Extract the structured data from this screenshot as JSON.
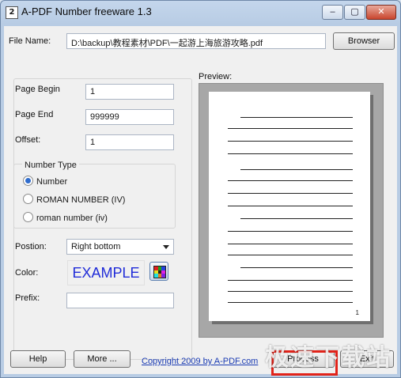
{
  "window": {
    "icon_text": "2",
    "title": "A-PDF Number freeware 1.3",
    "minimize_label": "–",
    "maximize_label": "▢",
    "close_label": "✕"
  },
  "file": {
    "label": "File Name:",
    "value": "D:\\backup\\教程素材\\PDF\\一起游上海旅游攻略.pdf",
    "browse_label": "Browser"
  },
  "settings": {
    "page_begin_label": "Page Begin",
    "page_begin_value": "1",
    "page_end_label": "Page End",
    "page_end_value": "999999",
    "offset_label": "Offset:",
    "offset_value": "1",
    "number_type_label": "Number Type",
    "number_types": [
      {
        "label": "Number",
        "selected": true
      },
      {
        "label": "ROMAN NUMBER (IV)",
        "selected": false
      },
      {
        "label": "roman number (iv)",
        "selected": false
      }
    ],
    "position_label": "Postion:",
    "position_value": "Right bottom",
    "color_label": "Color:",
    "color_example": "EXAMPLE",
    "example_color": "#1f2bd8",
    "prefix_label": "Prefix:",
    "prefix_value": ""
  },
  "preview": {
    "label": "Preview:",
    "page_number": "1"
  },
  "footer": {
    "help_label": "Help",
    "more_label": "More ...",
    "copyright_link": "Copyright 2009 by A-PDF.com",
    "process_label": "Process",
    "exit_label": "Exit"
  },
  "watermark": {
    "text": "极速下载站"
  },
  "icons": {
    "app": "app-icon",
    "color_picker": "color-grid-icon",
    "dropdown": "chevron-down-icon"
  }
}
